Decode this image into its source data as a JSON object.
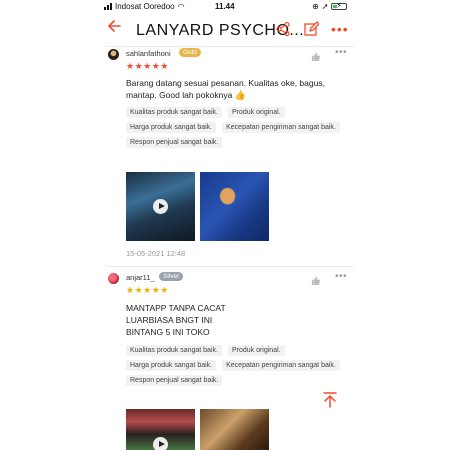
{
  "status_bar": {
    "carrier": "Indosat Ooredoo",
    "time": "11.44",
    "battery_level": 0.35
  },
  "header": {
    "title": "LANYARD PSYCHO...",
    "icons": [
      "back-arrow-icon",
      "share-icon",
      "edit-icon",
      "more-icon"
    ],
    "accent_color": "#ee4d2d"
  },
  "reviews": [
    {
      "username": "sahlanfathoni",
      "badge": "Gold",
      "rating": 5,
      "text": "Barang datang sesuai pesanan. Kualitas oke, bagus, mantap. Good lah pokoknya",
      "emoji": "👍",
      "tags": [
        "Kualitas produk sangat baik.",
        "Produk original.",
        "Harga produk sangat baik.",
        "Kecepatan pengiriman sangat baik.",
        "Respon penjual sangat baik."
      ],
      "date": "15-05-2021 12:48"
    },
    {
      "username": "anjar11_",
      "badge": "Silver",
      "rating": 5,
      "text": "MANTAPP TANPA CACAT\nLUARBIASA BNGT INI\nBINTANG 5 INI TOKO",
      "tags": [
        "Kualitas produk sangat baik.",
        "Produk original.",
        "Harga produk sangat baik.",
        "Kecepatan pengiriman sangat baik.",
        "Respon penjual sangat baik."
      ]
    }
  ]
}
